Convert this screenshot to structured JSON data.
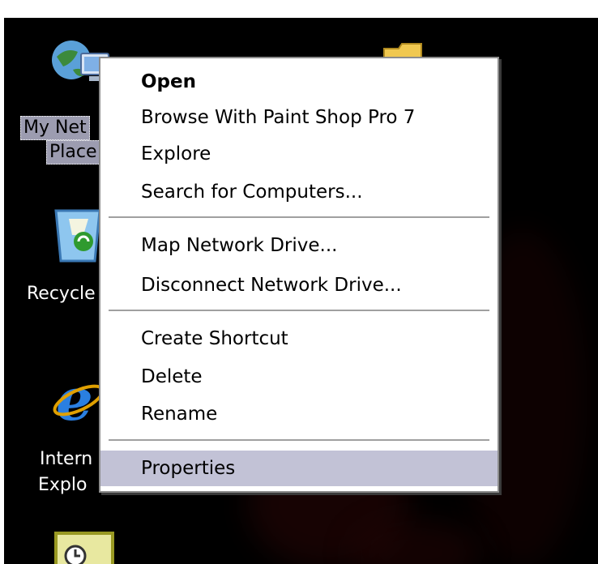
{
  "desktop": {
    "background_color": "#000000",
    "top_caption_clipped": "",
    "icons": [
      {
        "name": "My Network Places",
        "label_line1": "My Net",
        "label_line2": "Place",
        "selected": true,
        "icon": "network-places-icon"
      },
      {
        "name": "Recycle Bin",
        "label_line1": "Recycle",
        "icon": "recycle-bin-icon"
      },
      {
        "name": "Internet Explorer",
        "label_line1": "Intern",
        "label_line2": "Explo",
        "icon": "internet-explorer-icon"
      },
      {
        "name": "Shortcut",
        "icon": "clock-shortcut-icon"
      },
      {
        "name": "Folder",
        "icon": "folder-icon"
      }
    ]
  },
  "context_menu": {
    "items": [
      {
        "label": "Open",
        "default": true
      },
      {
        "label": "Browse With Paint Shop Pro 7"
      },
      {
        "label": "Explore"
      },
      {
        "label": "Search for Computers..."
      },
      {
        "label": "Map Network Drive..."
      },
      {
        "label": "Disconnect Network Drive..."
      },
      {
        "label": "Create Shortcut"
      },
      {
        "label": "Delete"
      },
      {
        "label": "Rename"
      },
      {
        "label": "Properties",
        "highlighted": true
      }
    ],
    "highlight_color": "#c2c2d6"
  }
}
